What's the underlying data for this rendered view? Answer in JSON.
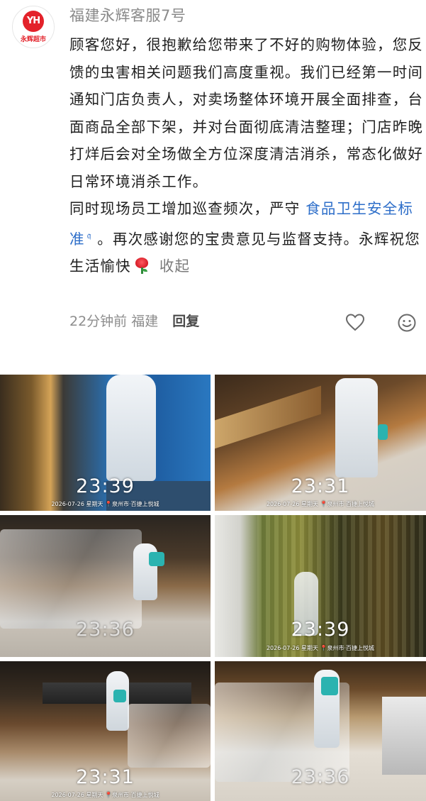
{
  "comment": {
    "avatar_logo": "YH",
    "avatar_caption": "永辉超市",
    "username": "福建永辉客服7号",
    "paragraph1": "顾客您好，很抱歉给您带来了不好的购物体验，您反馈的虫害相关问题我们高度重视。我们已经第一时间通知门店负责人，对卖场整体环境开展全面排查，台面商品全部下架，并对台面彻底清洁整理；门店昨晚打烊后会对全场做全方位深度清洁消杀，常态化做好日常环境消杀工作。",
    "paragraph2_before_link": "同时现场员工增加巡查频次，严守 ",
    "link_text": "食品卫生安全标准",
    "link_icon": "search-icon",
    "paragraph2_after_link": " 。再次感谢您的宝贵意见与监督支持。永辉祝您生活愉快",
    "emoji": "rose-emoji",
    "collapse_label": "收起",
    "time_ago": "22分钟前",
    "location": "福建",
    "reply_label": "回复",
    "icons": [
      "heart-icon",
      "emoji-icon"
    ]
  },
  "photos": [
    {
      "time": "23:39",
      "stamp_date": "2026-07-26 星期天",
      "stamp_place": "泉州市·百捷上悦城"
    },
    {
      "time": "23:31",
      "stamp_date": "2026-07-26 星期天",
      "stamp_place": "泉州市·百捷上悦城"
    },
    {
      "time": "23:36",
      "stamp_date": "",
      "stamp_place": ""
    },
    {
      "time": "23:39",
      "stamp_date": "2026-07-26 星期天",
      "stamp_place": "泉州市·百捷上悦城"
    },
    {
      "time": "23:31",
      "stamp_date": "2026-07-26 星期天",
      "stamp_place": "泉州市·百捷上悦城"
    },
    {
      "time": "23:36",
      "stamp_date": "",
      "stamp_place": ""
    }
  ],
  "colors": {
    "link": "#2d6ec9",
    "brand_red": "#e3222a",
    "muted": "#8d8d8d"
  }
}
